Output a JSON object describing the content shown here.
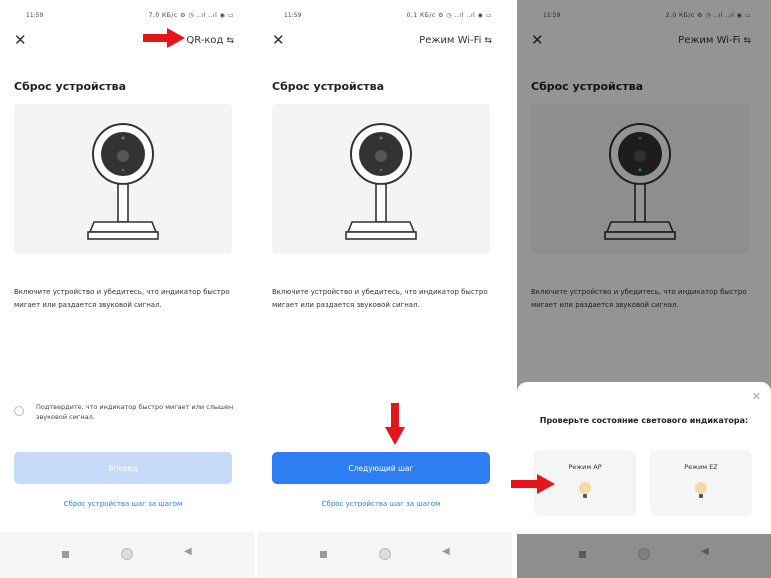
{
  "status_bar": [
    {
      "time": "11:59",
      "net": "7,0 КБ/с ⚙ ◷ ..ıl ..ıl ◉ ▭"
    },
    {
      "time": "11:59",
      "net": "0,1 КБ/с ⚙ ◷ ..ıl ..ıl ◉ ▭"
    },
    {
      "time": "11:59",
      "net": "2,0 КБ/с ⚙ ◷ ..ıl ..ıl ◉ ▭"
    }
  ],
  "screens": [
    {
      "mode_label": "QR-код",
      "title": "Сброс устройства",
      "description": "Включите устройство и убедитесь, что индикатор быстро мигает или раздается звуковой сигнал.",
      "confirm_text": "Подтвердите, что индикатор быстро мигает или слышен звуковой сигнал.",
      "button_label": "Вперед",
      "link_label": "Сброс устройства шаг за шагом"
    },
    {
      "mode_label": "Режим Wi-Fi",
      "title": "Сброс устройства",
      "description": "Включите устройство и убедитесь, что индикатор быстро мигает или раздается звуковой сигнал.",
      "button_label": "Следующий шаг",
      "link_label": "Сброс устройства шаг за шагом"
    },
    {
      "mode_label": "Режим Wi-Fi",
      "title": "Сброс устройства",
      "description": "Включите устройство и убедитесь, что индикатор быстро мигает или раздается звуковой сигнал.",
      "sheet": {
        "question": "Проверьте состояние светового индикатора:",
        "options": [
          "Режим AP",
          "Режим EZ"
        ]
      }
    }
  ],
  "icons": {
    "close": "close-icon",
    "swap": "swap-icon",
    "camera": "camera-illustration",
    "bulb": "bulb-icon",
    "arrow": "red-arrow"
  },
  "colors": {
    "primary": "#2e7ef3",
    "primary_disabled": "#c5d9f8",
    "arrow": "#e8141b",
    "image_bg": "#f3f4f6",
    "navbar_bg": "#f5f5f5"
  }
}
